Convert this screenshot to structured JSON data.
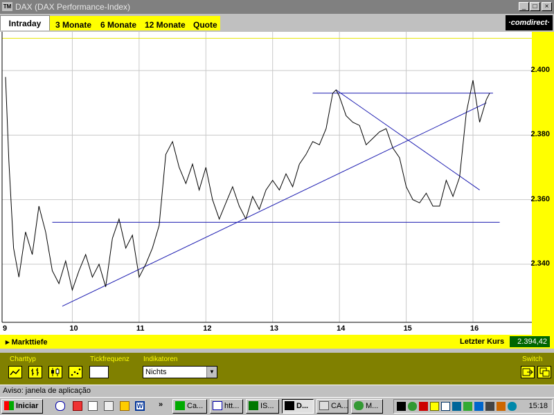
{
  "window": {
    "title": "DAX (DAX Performance-Index)",
    "app_icon": "TM",
    "btn_min": "_",
    "btn_max": "□",
    "btn_close": "×"
  },
  "tabs": {
    "active": "Intraday",
    "items": [
      "3 Monate",
      "6 Monate",
      "12 Monate",
      "Quote"
    ]
  },
  "brand": {
    "logo": "·comdirect·"
  },
  "chart_data": {
    "type": "line",
    "xlabel": "",
    "ylabel": "",
    "x_ticks": [
      "9",
      "10",
      "11",
      "12",
      "13",
      "14",
      "15",
      "16"
    ],
    "y_ticks": [
      "2.400",
      "2.380",
      "2.360",
      "2.340"
    ],
    "ylim": [
      2322,
      2412
    ],
    "grid": true,
    "series": [
      {
        "color": "#000000",
        "x": [
          9.0,
          9.05,
          9.12,
          9.2,
          9.3,
          9.4,
          9.5,
          9.6,
          9.7,
          9.8,
          9.9,
          10.0,
          10.1,
          10.2,
          10.3,
          10.4,
          10.5,
          10.6,
          10.7,
          10.8,
          10.9,
          11.0,
          11.1,
          11.2,
          11.3,
          11.4,
          11.5,
          11.6,
          11.7,
          11.8,
          11.9,
          12.0,
          12.1,
          12.2,
          12.3,
          12.4,
          12.5,
          12.6,
          12.7,
          12.8,
          12.9,
          13.0,
          13.1,
          13.2,
          13.3,
          13.4,
          13.5,
          13.6,
          13.7,
          13.8,
          13.9,
          13.95,
          14.0,
          14.1,
          14.2,
          14.3,
          14.4,
          14.5,
          14.6,
          14.7,
          14.8,
          14.9,
          15.0,
          15.1,
          15.2,
          15.3,
          15.4,
          15.5,
          15.6,
          15.7,
          15.8,
          15.9,
          16.0,
          16.1,
          16.2,
          16.25
        ],
        "values": [
          2398,
          2372,
          2345,
          2336,
          2350,
          2343,
          2358,
          2350,
          2338,
          2334,
          2341,
          2332,
          2338,
          2343,
          2336,
          2340,
          2333,
          2348,
          2354,
          2345,
          2349,
          2336,
          2340,
          2345,
          2352,
          2374,
          2378,
          2370,
          2365,
          2371,
          2363,
          2370,
          2360,
          2354,
          2359,
          2364,
          2358,
          2354,
          2361,
          2357,
          2363,
          2366,
          2363,
          2368,
          2364,
          2371,
          2374,
          2378,
          2377,
          2382,
          2393,
          2394,
          2392,
          2386,
          2384,
          2383,
          2377,
          2379,
          2381,
          2382,
          2376,
          2373,
          2364,
          2360,
          2359,
          2362,
          2358,
          2358,
          2366,
          2361,
          2367,
          2387,
          2397,
          2384,
          2391,
          2393
        ]
      }
    ],
    "lines": [
      {
        "label": "support",
        "x": [
          9.7,
          16.4
        ],
        "y": [
          2353,
          2353
        ]
      },
      {
        "label": "resistance",
        "x": [
          13.6,
          16.3
        ],
        "y": [
          2393,
          2393
        ]
      },
      {
        "label": "uptrend",
        "x": [
          9.85,
          16.2
        ],
        "y": [
          2327,
          2390
        ]
      },
      {
        "label": "downtrend",
        "x": [
          13.95,
          16.1
        ],
        "y": [
          2394,
          2363
        ]
      }
    ]
  },
  "infobar": {
    "markttiefe": "Markttiefe",
    "letzter_kurs_label": "Letzter Kurs",
    "letzter_kurs_value": "2.394,42"
  },
  "controls": {
    "charttyp_label": "Charttyp",
    "tickfrequenz_label": "Tickfrequenz",
    "indikatoren_label": "Indikatoren",
    "indikatoren_value": "Nichts",
    "switch_label": "Switch"
  },
  "statusbar": {
    "text": "Aviso: janela de aplicação"
  },
  "taskbar": {
    "start_label": "Iniciar",
    "more": "»",
    "buttons": [
      "Ca...",
      "htt...",
      "IS...",
      "D...",
      "CA...",
      "M..."
    ],
    "active_index": 3,
    "clock": "15:18"
  }
}
